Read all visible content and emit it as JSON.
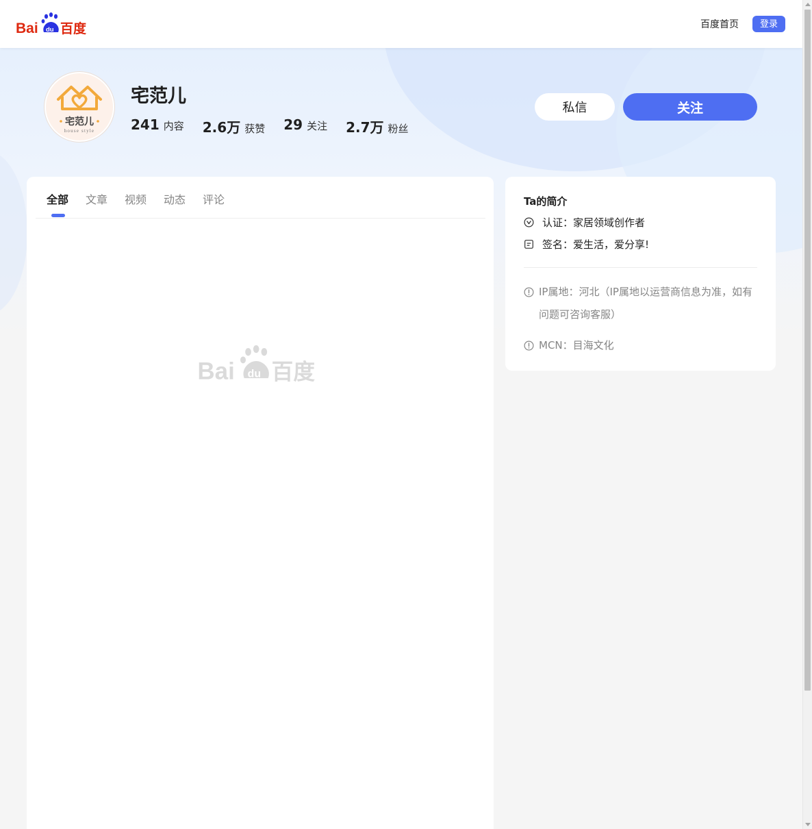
{
  "header": {
    "logo_text": "Bai百度",
    "nav_home": "百度首页",
    "login": "登录"
  },
  "profile": {
    "avatar_text": "宅范儿",
    "avatar_subtext": "house style",
    "name": "宅范儿",
    "stats": [
      {
        "value": "241",
        "label": "内容"
      },
      {
        "value": "2.6万",
        "label": "获赞"
      },
      {
        "value": "29",
        "label": "关注"
      },
      {
        "value": "2.7万",
        "label": "粉丝"
      }
    ],
    "message_button": "私信",
    "follow_button": "关注"
  },
  "tabs": [
    "全部",
    "文章",
    "视频",
    "动态",
    "评论"
  ],
  "active_tab": "全部",
  "watermark_text": "Bai百度",
  "intro": {
    "title": "Ta的简介",
    "certification": "认证：家居领域创作者",
    "signature": "签名：爱生活，爱分享!",
    "ip_note": "IP属地：河北（IP属地以运营商信息为准，如有问题可咨询客服）",
    "mcn": "MCN：目海文化"
  },
  "colors": {
    "accent": "#4e6ef2",
    "baidu_red": "#de2910",
    "baidu_blue": "#2932e1"
  },
  "icons": [
    "baidu-paw-icon",
    "verified-icon",
    "signature-icon",
    "info-icon"
  ]
}
